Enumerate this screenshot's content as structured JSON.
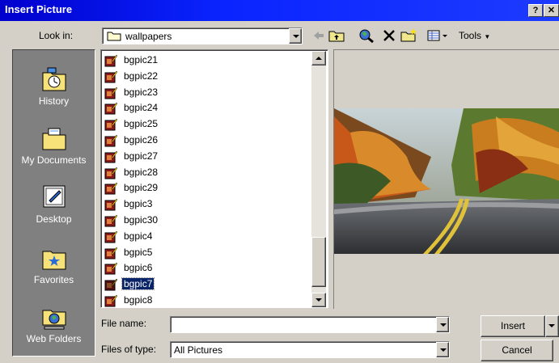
{
  "dialog": {
    "title": "Insert Picture",
    "help_label": "?",
    "close_label": "✕"
  },
  "toolbar": {
    "look_in_label": "Look in:",
    "look_in_value": "wallpapers",
    "tools_label": "Tools"
  },
  "places": [
    {
      "label": "History",
      "icon": "history-icon"
    },
    {
      "label": "My Documents",
      "icon": "my-documents-icon"
    },
    {
      "label": "Desktop",
      "icon": "desktop-icon"
    },
    {
      "label": "Favorites",
      "icon": "favorites-icon"
    },
    {
      "label": "Web Folders",
      "icon": "web-folders-icon"
    }
  ],
  "files": [
    "bgpic21",
    "bgpic22",
    "bgpic23",
    "bgpic24",
    "bgpic25",
    "bgpic26",
    "bgpic27",
    "bgpic28",
    "bgpic29",
    "bgpic3",
    "bgpic30",
    "bgpic4",
    "bgpic5",
    "bgpic6",
    "bgpic7",
    "bgpic8"
  ],
  "selected_file": "bgpic7",
  "form": {
    "file_name_label": "File name:",
    "file_name_value": "",
    "file_type_label": "Files of type:",
    "file_type_value": "All Pictures"
  },
  "buttons": {
    "insert_label": "Insert",
    "cancel_label": "Cancel"
  },
  "colors": {
    "title_bar": "#0a24ff",
    "selection": "#0a246a",
    "places_bg": "#808080"
  }
}
